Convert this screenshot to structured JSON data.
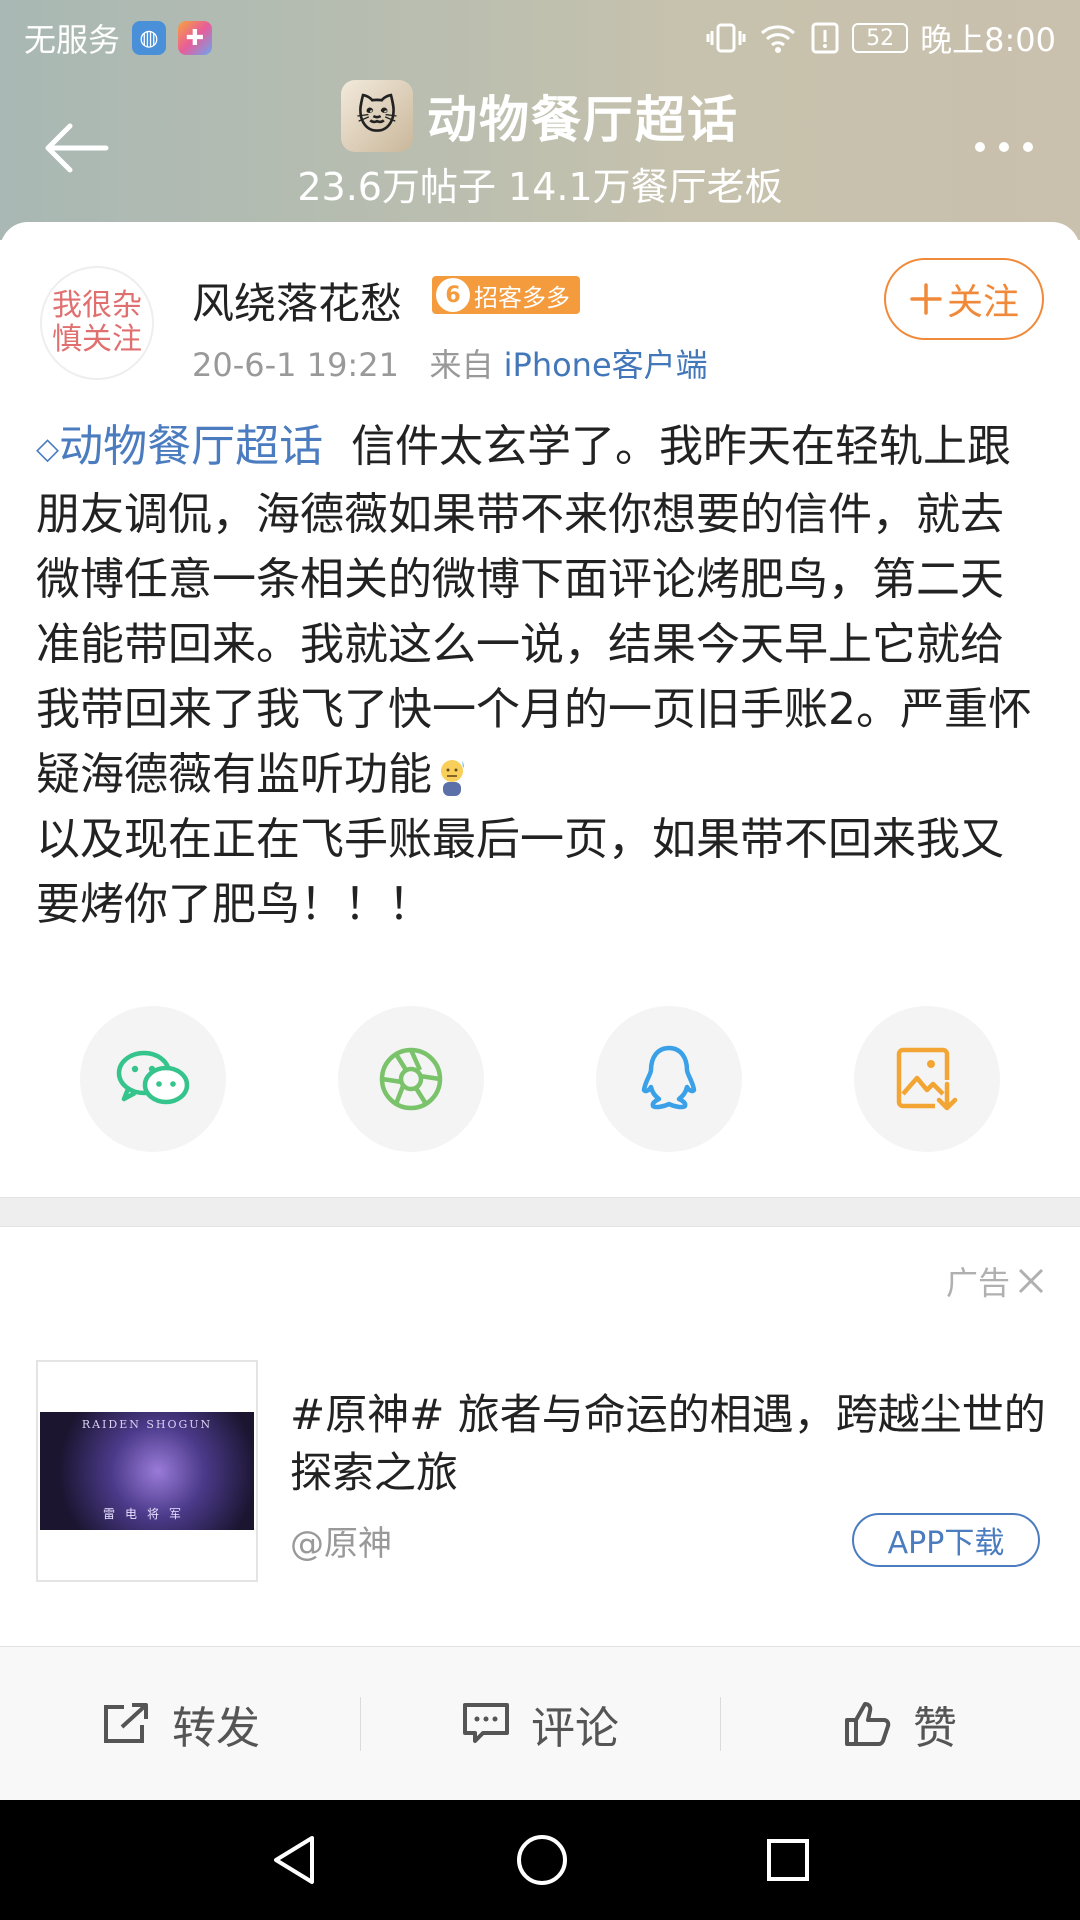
{
  "status_bar": {
    "carrier": "无服务",
    "battery": "52",
    "time": "晚上8:00"
  },
  "header": {
    "topic_title": "动物餐厅超话",
    "stats": "23.6万帖子 14.1万餐厅老板"
  },
  "post": {
    "user": {
      "name": "风绕落花愁",
      "badge_level": "6",
      "badge_label": "招客多多",
      "avatar_text_line1": "我很杂",
      "avatar_text_line2": "慎关注"
    },
    "date": "20-6-1 19:21",
    "from_label": "来自",
    "client": "iPhone客户端",
    "follow_label": "关注",
    "topic_link": "动物餐厅超话",
    "text_part1": "信件太玄学了。我昨天在轻轨上跟朋友调侃，海德薇如果带不来你想要的信件，就去微博任意一条相关的微博下面评论烤肥鸟，第二天准能带回来。我就这么一说，结果今天早上它就给我带回来了我飞了快一个月的一页旧手账2。严重怀疑海德薇有监听功能",
    "text_part2": "以及现在正在飞手账最后一页，如果带不回来我又要烤你了肥鸟！！！"
  },
  "share": {
    "items": [
      "wechat-icon",
      "moments-icon",
      "qq-icon",
      "save-image-icon"
    ]
  },
  "ad": {
    "label": "广告",
    "title": "#原神# 旅者与命运的相遇，跨越尘世的探索之旅",
    "source": "@原神",
    "button": "APP下载",
    "thumb_title": "RAIDEN SHOGUN",
    "thumb_subtitle": "雷电将军"
  },
  "actions": {
    "repost": "转发",
    "comment": "评论",
    "like": "赞"
  },
  "colors": {
    "accent_orange": "#f08a3a",
    "link_blue": "#4b7cc0",
    "wechat_green": "#35c48c",
    "qq_blue": "#3aa0e8",
    "save_orange": "#f3a534"
  }
}
